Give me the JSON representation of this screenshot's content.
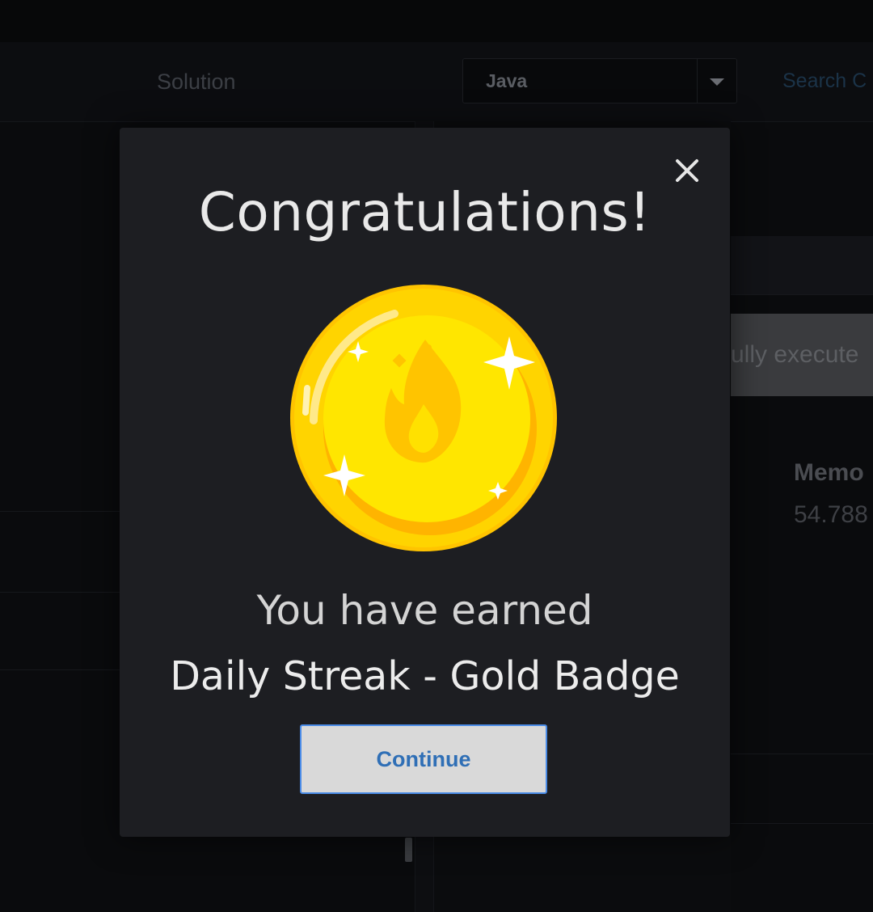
{
  "background": {
    "tab_solution": "Solution",
    "language_select_value": "Java",
    "search_link": "Search C",
    "result_banner_text": "ully execute",
    "memory_label": "Memo",
    "memory_value": "54.788"
  },
  "modal": {
    "title": "Congratulations!",
    "earned_text": "You have earned",
    "badge_name": "Daily Streak - Gold Badge",
    "continue_label": "Continue",
    "close_icon": "close-icon",
    "badge_icon": "gold-coin-flame-icon"
  },
  "colors": {
    "accent": "#4a8be6",
    "button_text": "#2f6fb6",
    "modal_bg": "#1d1e22",
    "coin_gold": "#ffcc00"
  }
}
